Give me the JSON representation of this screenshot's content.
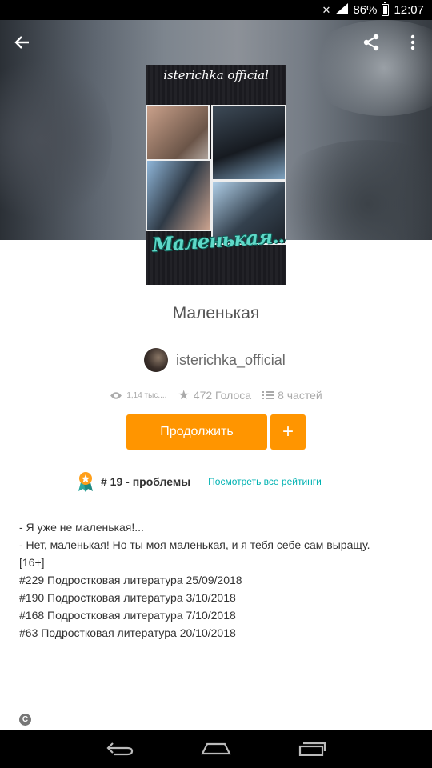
{
  "status_bar": {
    "battery": "86%",
    "time": "12:07"
  },
  "header": {
    "icons": [
      "back-arrow-icon",
      "share-icon",
      "more-vert-icon"
    ]
  },
  "cover": {
    "author_text": "isterichka official",
    "title_text": "Маленькая..."
  },
  "story": {
    "title": "Маленькая",
    "author": "isterichka_official",
    "views": "1,14 тыс....",
    "votes": "472 Голоса",
    "parts": "8 частей"
  },
  "actions": {
    "continue_label": "Продолжить",
    "add_label": "+"
  },
  "ranking": {
    "rank": "# 19 - проблемы",
    "link": "Посмотреть все рейтинги"
  },
  "description": {
    "lines": [
      "- Я уже не маленькая!...",
      "",
      "- Нет, маленькая! Но ты моя маленькая, и я тебя себе сам выращу.",
      "",
      "[16+]",
      "",
      "#229 Подростковая литература 25/09/2018",
      "#190 Подростковая литература 3/10/2018",
      "#168 Подростковая литература 7/10/2018",
      "#63 Подростковая литература 20/10/2018"
    ]
  },
  "colors": {
    "accent": "#ff9500",
    "link": "#00b2b2"
  }
}
